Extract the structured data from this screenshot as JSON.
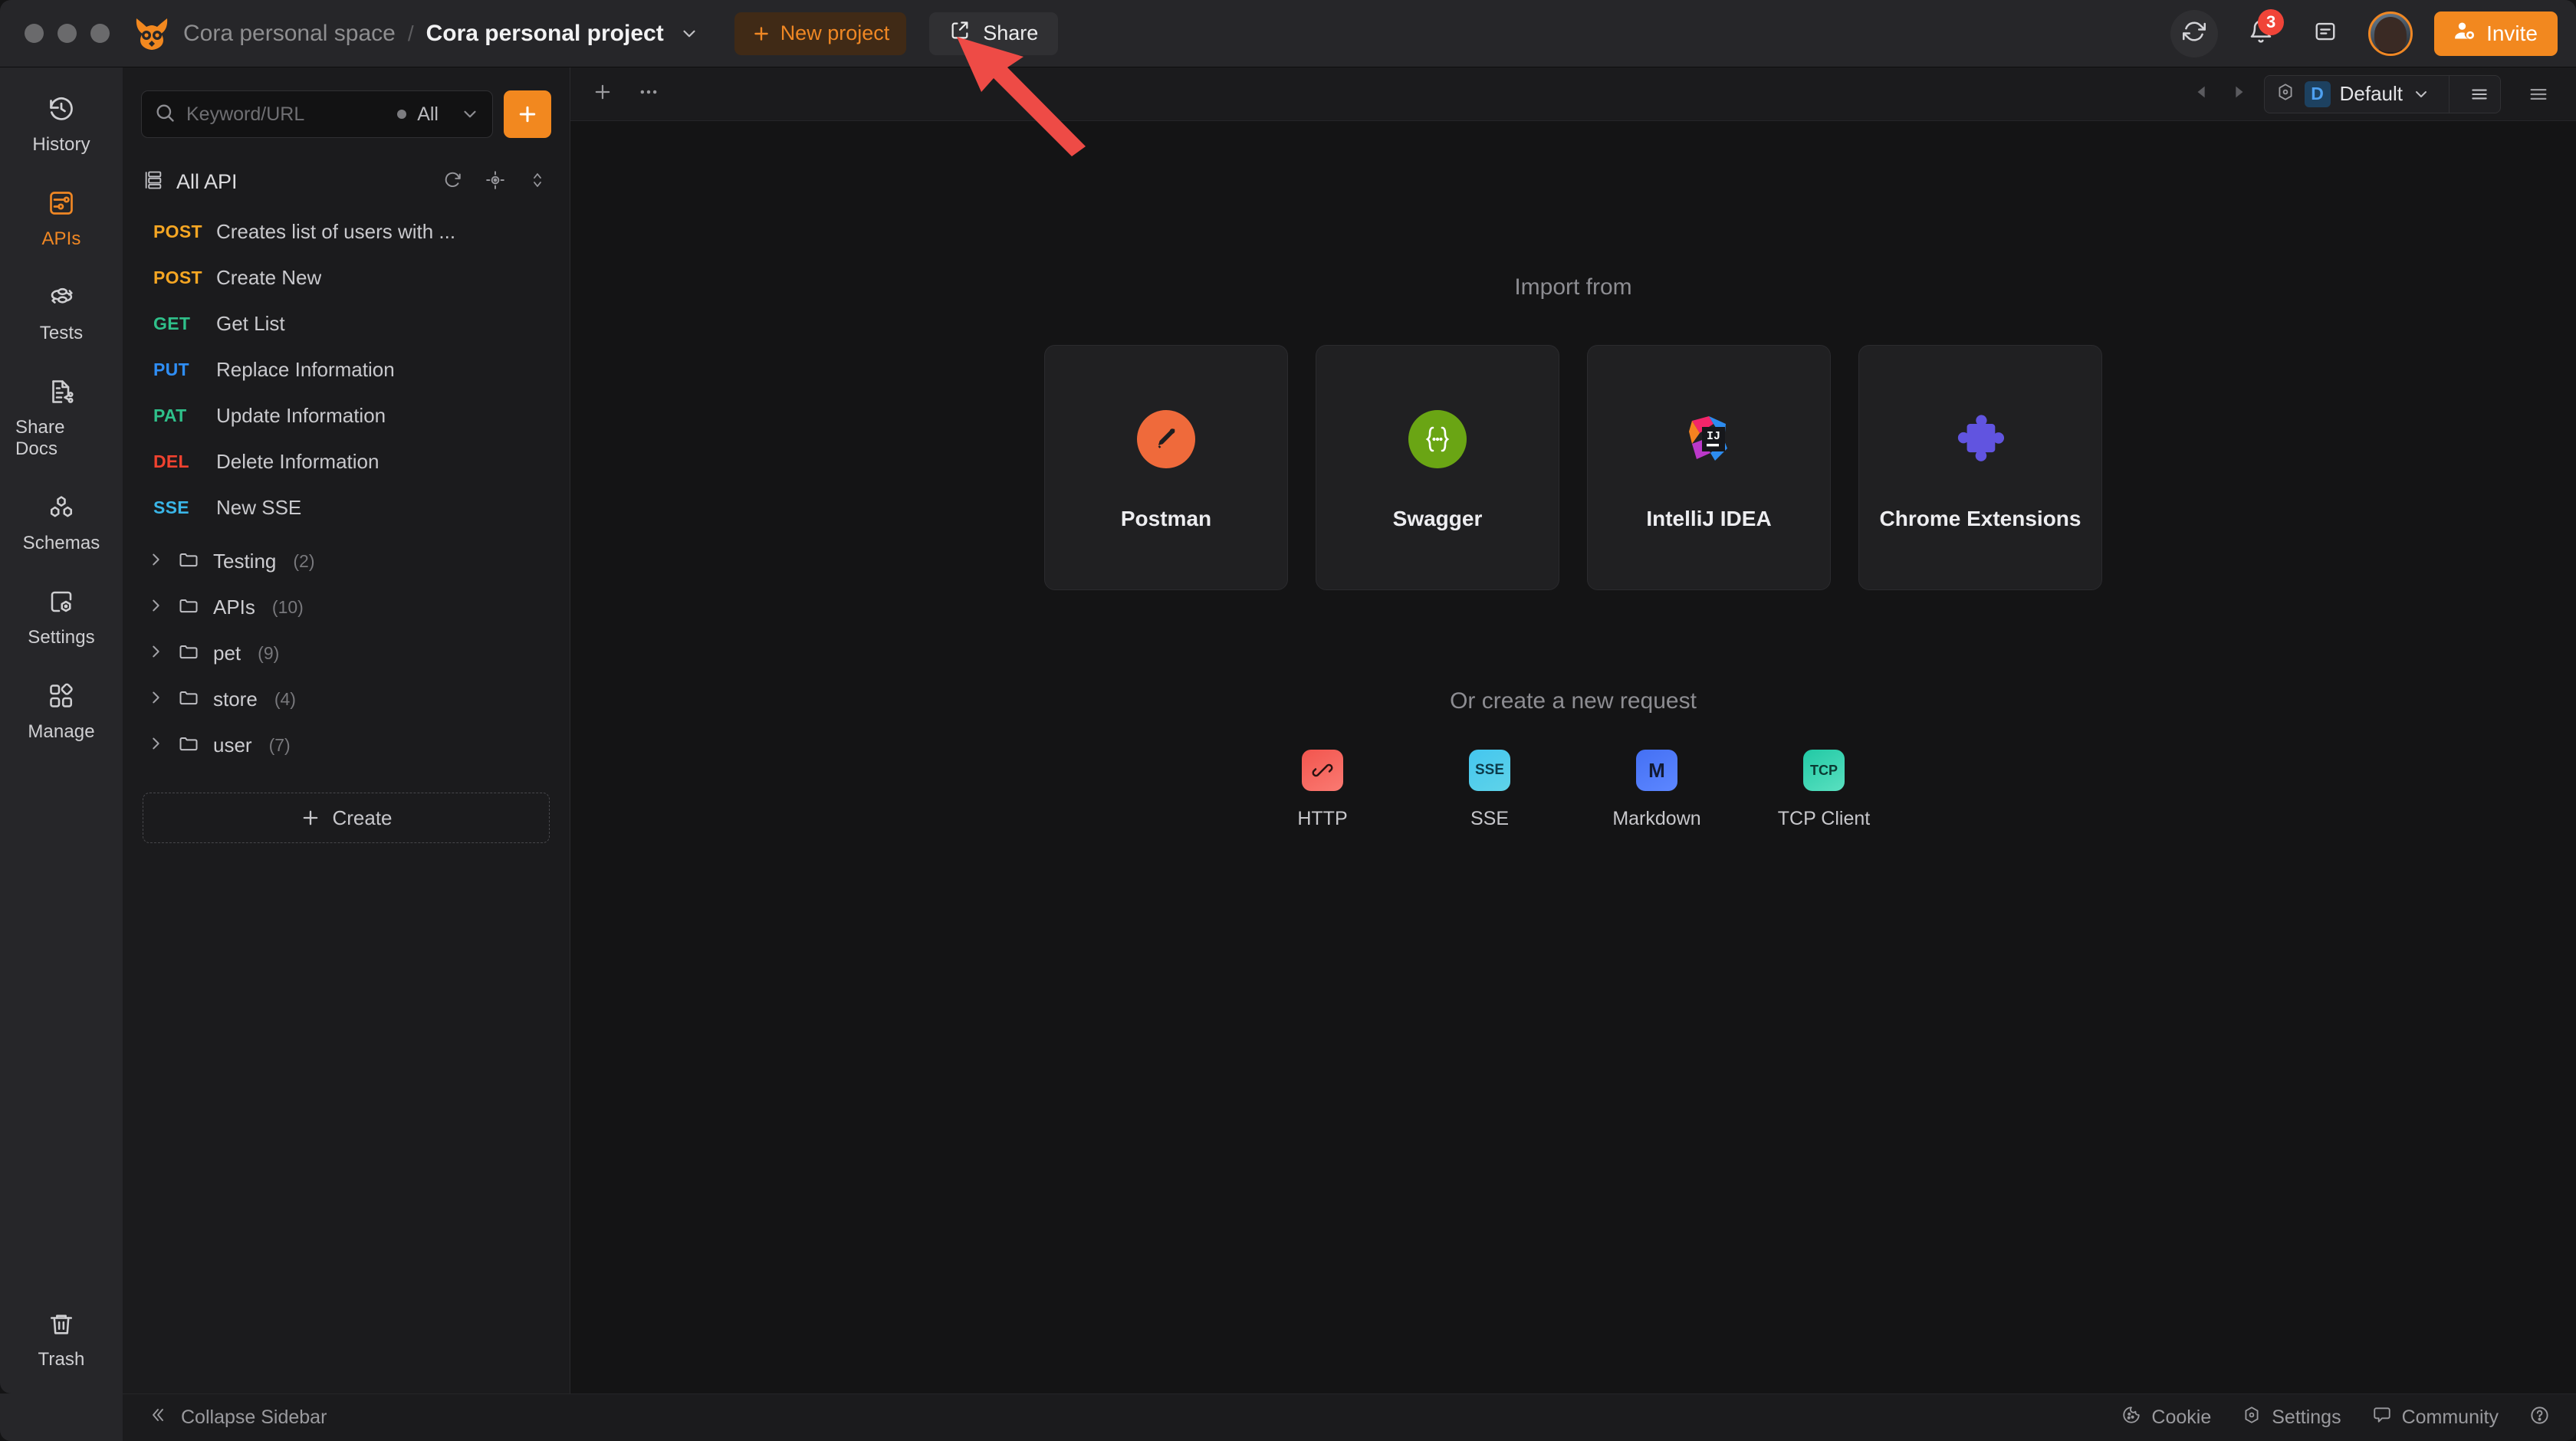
{
  "titlebar": {
    "workspace": "Cora personal space",
    "separator": "/",
    "project": "Cora personal project",
    "new_project": "New project",
    "share": "Share",
    "invite": "Invite",
    "notification_count": "3",
    "accent_color": "#f2881f"
  },
  "rail": {
    "items": [
      {
        "label": "History",
        "icon": "history-icon",
        "active": false
      },
      {
        "label": "APIs",
        "icon": "sliders-icon",
        "active": true
      },
      {
        "label": "Tests",
        "icon": "flow-icon",
        "active": false
      },
      {
        "label": "Share Docs",
        "icon": "doc-share-icon",
        "active": false
      },
      {
        "label": "Schemas",
        "icon": "hexagons-icon",
        "active": false
      },
      {
        "label": "Settings",
        "icon": "settings-icon",
        "active": false
      },
      {
        "label": "Manage",
        "icon": "grid-icon",
        "active": false
      }
    ],
    "bottom": {
      "label": "Trash",
      "icon": "trash-icon"
    }
  },
  "sidebar": {
    "search": {
      "placeholder": "Keyword/URL",
      "filter": "All"
    },
    "add_button": "+",
    "group_title": "All API",
    "apis": [
      {
        "method": "POST",
        "name": "Creates list of users with ...",
        "cls": "m-post"
      },
      {
        "method": "POST",
        "name": "Create New",
        "cls": "m-post"
      },
      {
        "method": "GET",
        "name": "Get List",
        "cls": "m-get"
      },
      {
        "method": "PUT",
        "name": "Replace Information",
        "cls": "m-put"
      },
      {
        "method": "PAT",
        "name": "Update Information",
        "cls": "m-pat"
      },
      {
        "method": "DEL",
        "name": "Delete Information",
        "cls": "m-del"
      },
      {
        "method": "SSE",
        "name": "New SSE",
        "cls": "m-sse"
      }
    ],
    "folders": [
      {
        "name": "Testing",
        "count": "(2)"
      },
      {
        "name": "APIs",
        "count": "(10)"
      },
      {
        "name": "pet",
        "count": "(9)"
      },
      {
        "name": "store",
        "count": "(4)"
      },
      {
        "name": "user",
        "count": "(7)"
      }
    ],
    "create": "Create"
  },
  "tabbar": {
    "environment": {
      "badge": "D",
      "name": "Default"
    }
  },
  "main": {
    "import_title": "Import from",
    "import_cards": [
      {
        "label": "Postman",
        "icon": "postman-icon"
      },
      {
        "label": "Swagger",
        "icon": "swagger-icon"
      },
      {
        "label": "IntelliJ IDEA",
        "icon": "intellij-icon"
      },
      {
        "label": "Chrome Extensions",
        "icon": "puzzle-icon"
      }
    ],
    "create_title": "Or create a new request",
    "request_types": [
      {
        "label": "HTTP",
        "glyph": "",
        "cls": "ico-http",
        "icon": "http-icon"
      },
      {
        "label": "SSE",
        "glyph": "SSE",
        "cls": "ico-sse",
        "icon": "sse-icon"
      },
      {
        "label": "Markdown",
        "glyph": "M",
        "cls": "ico-md",
        "icon": "markdown-icon"
      },
      {
        "label": "TCP Client",
        "glyph": "TCP",
        "cls": "ico-tcp",
        "icon": "tcp-icon"
      }
    ]
  },
  "statusbar": {
    "collapse": "Collapse Sidebar",
    "items": [
      {
        "label": "Cookie",
        "icon": "cookie-icon"
      },
      {
        "label": "Settings",
        "icon": "settings-icon"
      },
      {
        "label": "Community",
        "icon": "chat-icon"
      }
    ],
    "help": "?"
  },
  "annotation": {
    "type": "arrow",
    "color": "#ee4b46",
    "points_to": "share-button"
  }
}
